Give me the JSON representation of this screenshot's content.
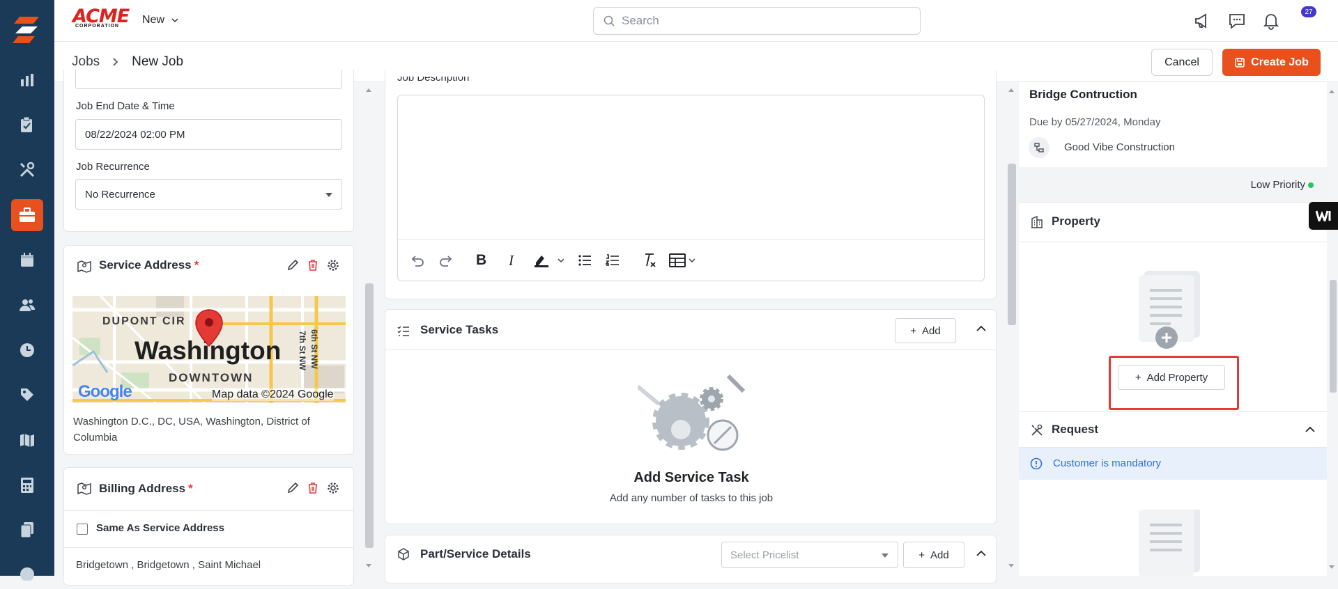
{
  "topbar": {
    "logo_text": "ACME",
    "logo_sub": "CORPORATION",
    "new_label": "New",
    "search_placeholder": "Search",
    "notif_count": "27"
  },
  "breadcrumb": {
    "parent": "Jobs",
    "current": "New Job"
  },
  "actions": {
    "cancel": "Cancel",
    "create": "Create Job"
  },
  "left": {
    "end_label": "Job End Date & Time",
    "end_value": "08/22/2024 02:00 PM",
    "recurrence_label": "Job Recurrence",
    "recurrence_value": "No Recurrence",
    "service_address_title": "Service Address",
    "map": {
      "area1": "DUPONT CIR",
      "city": "Washington",
      "area2": "DOWNTOWN",
      "street1": "6th St NW",
      "street2": "7th St NW",
      "google": "Google",
      "credit": "Map data ©2024 Google"
    },
    "service_address_text": "Washington D.C., DC, USA, Washington, District of Columbia",
    "billing_title": "Billing Address",
    "same_as": "Same As Service Address",
    "billing_text": "Bridgetown , Bridgetown , Saint Michael",
    "required_mark": "*"
  },
  "middle": {
    "description_label": "Job Description",
    "service_tasks_title": "Service Tasks",
    "add_label": "Add",
    "empty_title": "Add Service Task",
    "empty_sub": "Add any number of tasks to this job",
    "part_title": "Part/Service Details",
    "pricelist_placeholder": "Select Pricelist"
  },
  "right": {
    "job_title": "Bridge Contruction",
    "due": "Due by 05/27/2024, Monday",
    "customer": "Good Vibe Construction",
    "priority": "Low Priority",
    "priority_color": "#22c55e",
    "property_title": "Property",
    "add_property": "Add Property",
    "request_title": "Request",
    "customer_mandatory": "Customer is mandatory"
  },
  "colors": {
    "sidebar": "#1b3a57",
    "accent": "#e8501e",
    "highlight": "#e5383b",
    "info": "#2f6fde"
  }
}
